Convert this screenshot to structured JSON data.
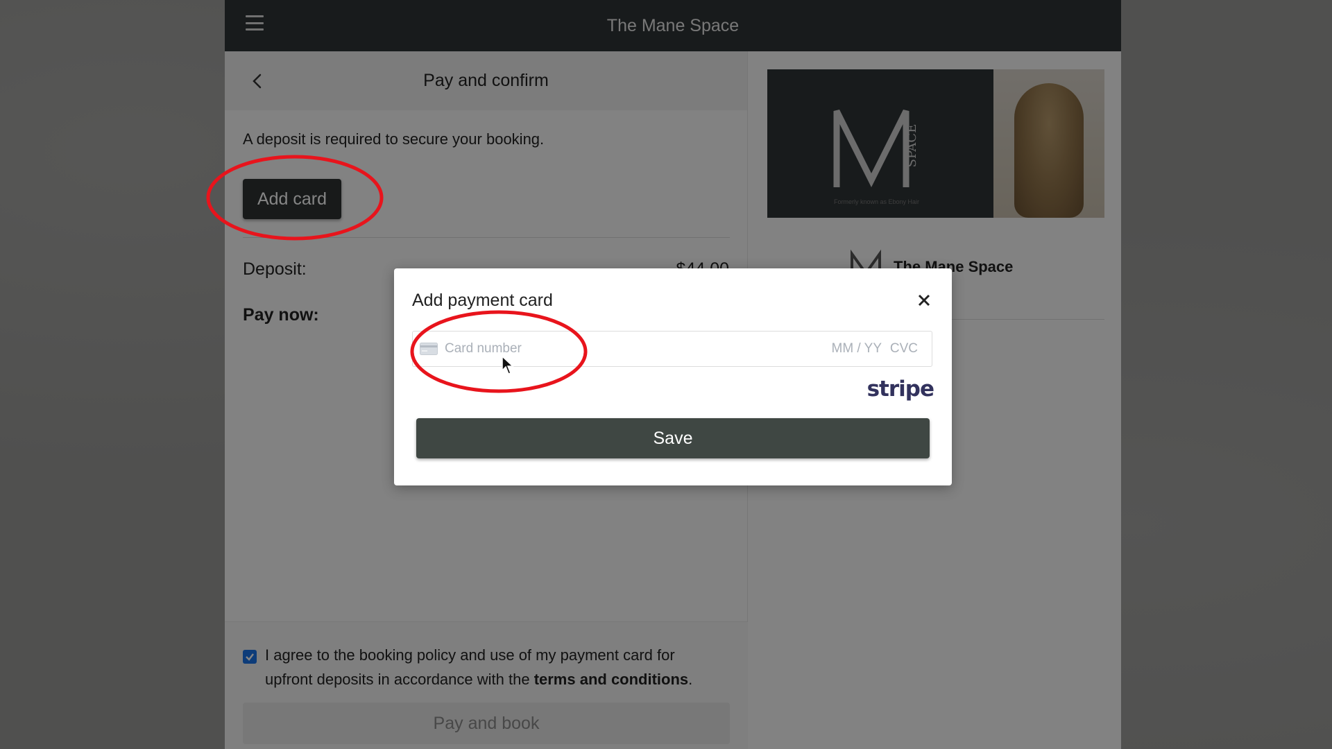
{
  "app": {
    "title": "The Mane Space"
  },
  "booking": {
    "header_title": "Pay and confirm",
    "deposit_note": "A deposit is required to secure your booking.",
    "add_card_label": "Add card",
    "deposit_label": "Deposit:",
    "deposit_value": "$44.00",
    "pay_now_label": "Pay now:",
    "agree_text_before": "I agree to the booking policy and use of my payment card for upfront deposits in accordance with the ",
    "agree_link": "terms and conditions",
    "agree_text_after": ".",
    "agree_checked": true,
    "pay_and_book_label": "Pay and book"
  },
  "salon": {
    "name": "The Mane Space",
    "banner_logo_letter": "M",
    "banner_logo_word": "SPACE",
    "banner_subtitle": "Formerly known as Ebony Hair"
  },
  "modal": {
    "title": "Add payment card",
    "card_number_placeholder": "Card number",
    "expiry_placeholder": "MM / YY",
    "cvc_placeholder": "CVC",
    "processor": "stripe",
    "save_label": "Save"
  },
  "colors": {
    "topbar": "#2f3436",
    "primary_button": "#2e3333",
    "save_button": "#3f4743",
    "checkbox": "#1a73e8",
    "annotation": "#e8141c",
    "stripe": "#32325d"
  }
}
